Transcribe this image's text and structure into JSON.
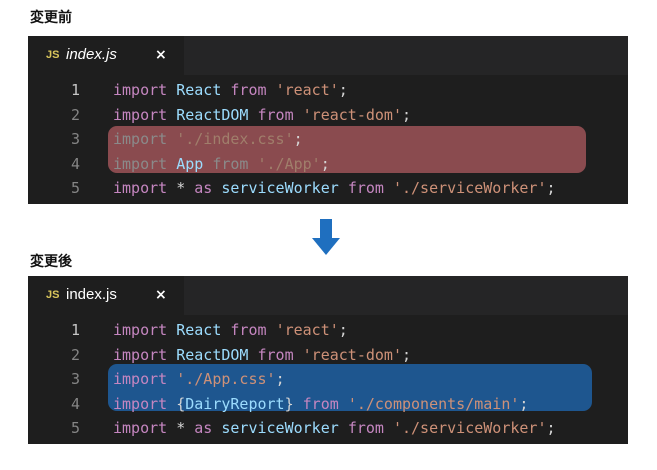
{
  "before": {
    "heading": "変更前",
    "tab": {
      "badge": "JS",
      "name": "index.js",
      "close": "×"
    },
    "lines": [
      {
        "num": "1",
        "parts": [
          "import",
          " ",
          "React",
          " ",
          "from",
          " ",
          "'react'",
          ";"
        ]
      },
      {
        "num": "2",
        "parts": [
          "import",
          " ",
          "ReactDOM",
          " ",
          "from",
          " ",
          "'react-dom'",
          ";"
        ]
      },
      {
        "num": "3",
        "parts": [
          "import",
          " ",
          "'./index.css'",
          ";"
        ]
      },
      {
        "num": "4",
        "parts": [
          "import",
          " ",
          "App",
          " ",
          "from",
          " ",
          "'./App'",
          ";"
        ]
      },
      {
        "num": "5",
        "parts": [
          "import",
          " ",
          "*",
          " ",
          "as",
          " ",
          "serviceWorker",
          " ",
          "from",
          " ",
          "'./serviceWorker'",
          ";"
        ]
      }
    ]
  },
  "after": {
    "heading": "変更後",
    "tab": {
      "badge": "JS",
      "name": "index.js",
      "close": "×"
    },
    "lines": [
      {
        "num": "1",
        "parts": [
          "import",
          " ",
          "React",
          " ",
          "from",
          " ",
          "'react'",
          ";"
        ]
      },
      {
        "num": "2",
        "parts": [
          "import",
          " ",
          "ReactDOM",
          " ",
          "from",
          " ",
          "'react-dom'",
          ";"
        ]
      },
      {
        "num": "3",
        "parts": [
          "import",
          " ",
          "'./App.css'",
          ";"
        ]
      },
      {
        "num": "4",
        "parts": [
          "import",
          " ",
          "{DairyReport}",
          " ",
          "from",
          " ",
          "'./components/main'",
          ";"
        ]
      },
      {
        "num": "5",
        "parts": [
          "import",
          " ",
          "*",
          " ",
          "as",
          " ",
          "serviceWorker",
          " ",
          "from",
          " ",
          "'./serviceWorker'",
          ";"
        ]
      }
    ]
  },
  "colors": {
    "editor_bg": "#1e1e1e",
    "tabbar_bg": "#252526",
    "before_highlight": "#a9595d",
    "after_highlight": "#1f5a96",
    "arrow": "#1f6fbf",
    "keyword": "#c586c0",
    "identifier": "#9cdcfe",
    "string": "#ce9178",
    "js_badge": "#d9c65c"
  },
  "icons": {
    "arrow": "arrow-down-icon",
    "close": "close-icon",
    "js": "javascript-file-icon"
  }
}
